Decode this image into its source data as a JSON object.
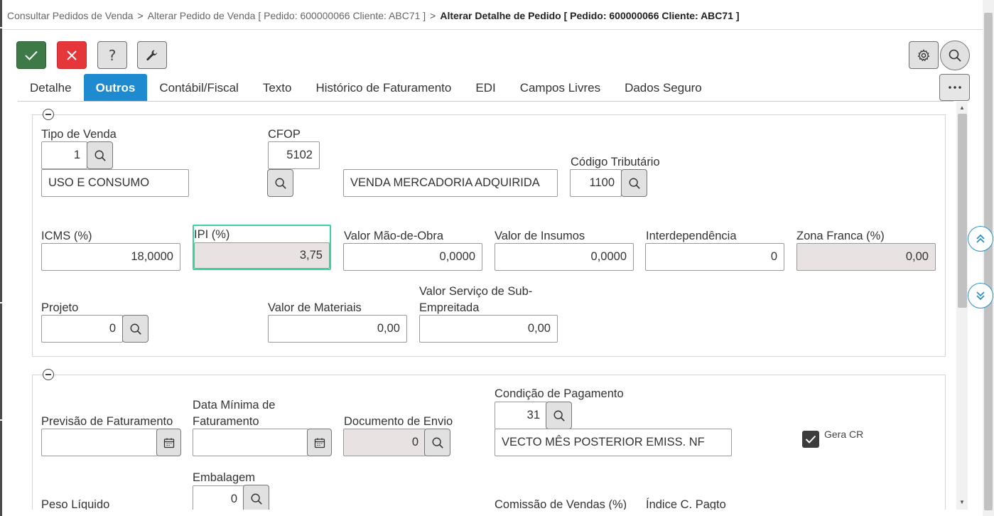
{
  "breadcrumb": {
    "items": [
      "Consultar Pedidos de Venda",
      "Alterar Pedido de Venda [ Pedido: 600000066 Cliente: ABC71 ]"
    ],
    "current": "Alterar Detalhe de Pedido [ Pedido: 600000066 Cliente: ABC71 ]",
    "separator": ">"
  },
  "toolbar": {
    "confirm_icon": "check-icon",
    "cancel_icon": "close-icon",
    "help_label": "?",
    "tools_icon": "wrench-icon",
    "settings_icon": "gear-icon",
    "search_icon": "search-icon",
    "more_icon": "more-horizontal-icon"
  },
  "tabs": [
    {
      "label": "Detalhe",
      "active": false
    },
    {
      "label": "Outros",
      "active": true
    },
    {
      "label": "Contábil/Fiscal",
      "active": false
    },
    {
      "label": "Texto",
      "active": false
    },
    {
      "label": "Histórico de Faturamento",
      "active": false
    },
    {
      "label": "EDI",
      "active": false
    },
    {
      "label": "Campos Livres",
      "active": false
    },
    {
      "label": "Dados Seguro",
      "active": false
    }
  ],
  "section1": {
    "tipo_venda": {
      "label": "Tipo de Venda",
      "value": "1",
      "description": "USO E CONSUMO"
    },
    "cfop": {
      "label": "CFOP",
      "value": "5102",
      "description": "VENDA MERCADORIA ADQUIRIDA"
    },
    "codigo_tributario": {
      "label": "Código Tributário",
      "value": "1100"
    },
    "icms": {
      "label": "ICMS (%)",
      "value": "18,0000"
    },
    "ipi": {
      "label": "IPI (%)",
      "value": "3,75"
    },
    "valor_mao_obra": {
      "label": "Valor Mão-de-Obra",
      "value": "0,0000"
    },
    "valor_insumos": {
      "label": "Valor de Insumos",
      "value": "0,0000"
    },
    "interdependencia": {
      "label": "Interdependência",
      "value": "0"
    },
    "zona_franca": {
      "label": "Zona Franca (%)",
      "value": "0,00"
    },
    "projeto": {
      "label": "Projeto",
      "value": "0"
    },
    "valor_materiais": {
      "label": "Valor de Materiais",
      "value": "0,00"
    },
    "valor_servico": {
      "label": "Valor Serviço de Sub-Empreitada",
      "value": "0,00"
    }
  },
  "section2": {
    "previsao_faturamento": {
      "label": "Previsão de Faturamento",
      "value": ""
    },
    "data_minima": {
      "label": "Data Mínima de Faturamento",
      "value": ""
    },
    "documento_envio": {
      "label": "Documento de Envio",
      "value": "0"
    },
    "condicao_pagamento": {
      "label": "Condição de Pagamento",
      "value": "31",
      "description": "VECTO MÊS POSTERIOR EMISS. NF"
    },
    "gera_cr": {
      "label": "Gera CR",
      "checked": true
    },
    "embalagem": {
      "label": "Embalagem",
      "value": "0"
    },
    "peso_liquido": {
      "label": "Peso Líquido"
    },
    "comissao_vendas": {
      "label": "Comissão de Vendas (%)"
    },
    "indice_c_pagto": {
      "label": "Índice C. Pagto"
    }
  },
  "colors": {
    "accent": "#1e8bd1",
    "confirm": "#3d7a47",
    "cancel": "#e5373a",
    "focus_border": "#3ad59a",
    "readonly_bg": "#e8e2e2"
  }
}
